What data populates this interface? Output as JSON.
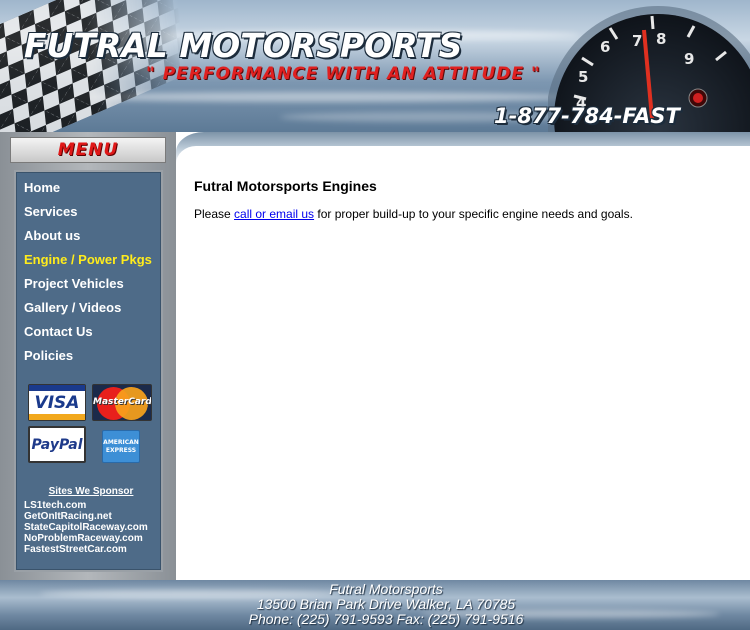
{
  "header": {
    "title": "FUTRAL MOTORSPORTS",
    "tagline": "\" PERFORMANCE WITH AN ATTITUDE \"",
    "phone": "1-877-784-FAST"
  },
  "menu": {
    "title": "MENU",
    "items": [
      {
        "label": "Home",
        "active": false
      },
      {
        "label": "Services",
        "active": false
      },
      {
        "label": "About us",
        "active": false
      },
      {
        "label": "Engine / Power Pkgs",
        "active": true
      },
      {
        "label": "Project Vehicles",
        "active": false
      },
      {
        "label": "Gallery / Videos",
        "active": false
      },
      {
        "label": "Contact Us",
        "active": false
      },
      {
        "label": "Policies",
        "active": false
      }
    ],
    "active_color": "#ffec1c"
  },
  "payment_logos": {
    "visa": "VISA",
    "mastercard": "MasterCard",
    "paypal": "PayPal",
    "amex": "AMERICAN EXPRESS"
  },
  "sponsors": {
    "title": "Sites We Sponsor",
    "links": [
      "LS1tech.com",
      "GetOnItRacing.net",
      "StateCapitolRaceway.com",
      "NoProblemRaceway.com",
      "FastestStreetCar.com"
    ]
  },
  "main": {
    "title": "Futral Motorsports Engines",
    "intro_prefix": "Please ",
    "intro_link": "call or email us",
    "intro_suffix": " for proper build-up to your specific engine needs and goals."
  },
  "footer": {
    "company": "Futral Motorsports",
    "address": "13500 Brian Park Drive  Walker, LA 70785",
    "contact": "Phone: (225) 791-9593  Fax: (225) 791-9516"
  },
  "colors": {
    "link": "#0000ee",
    "menu_panel": "#4e6b88",
    "accent_red": "#e01818"
  }
}
